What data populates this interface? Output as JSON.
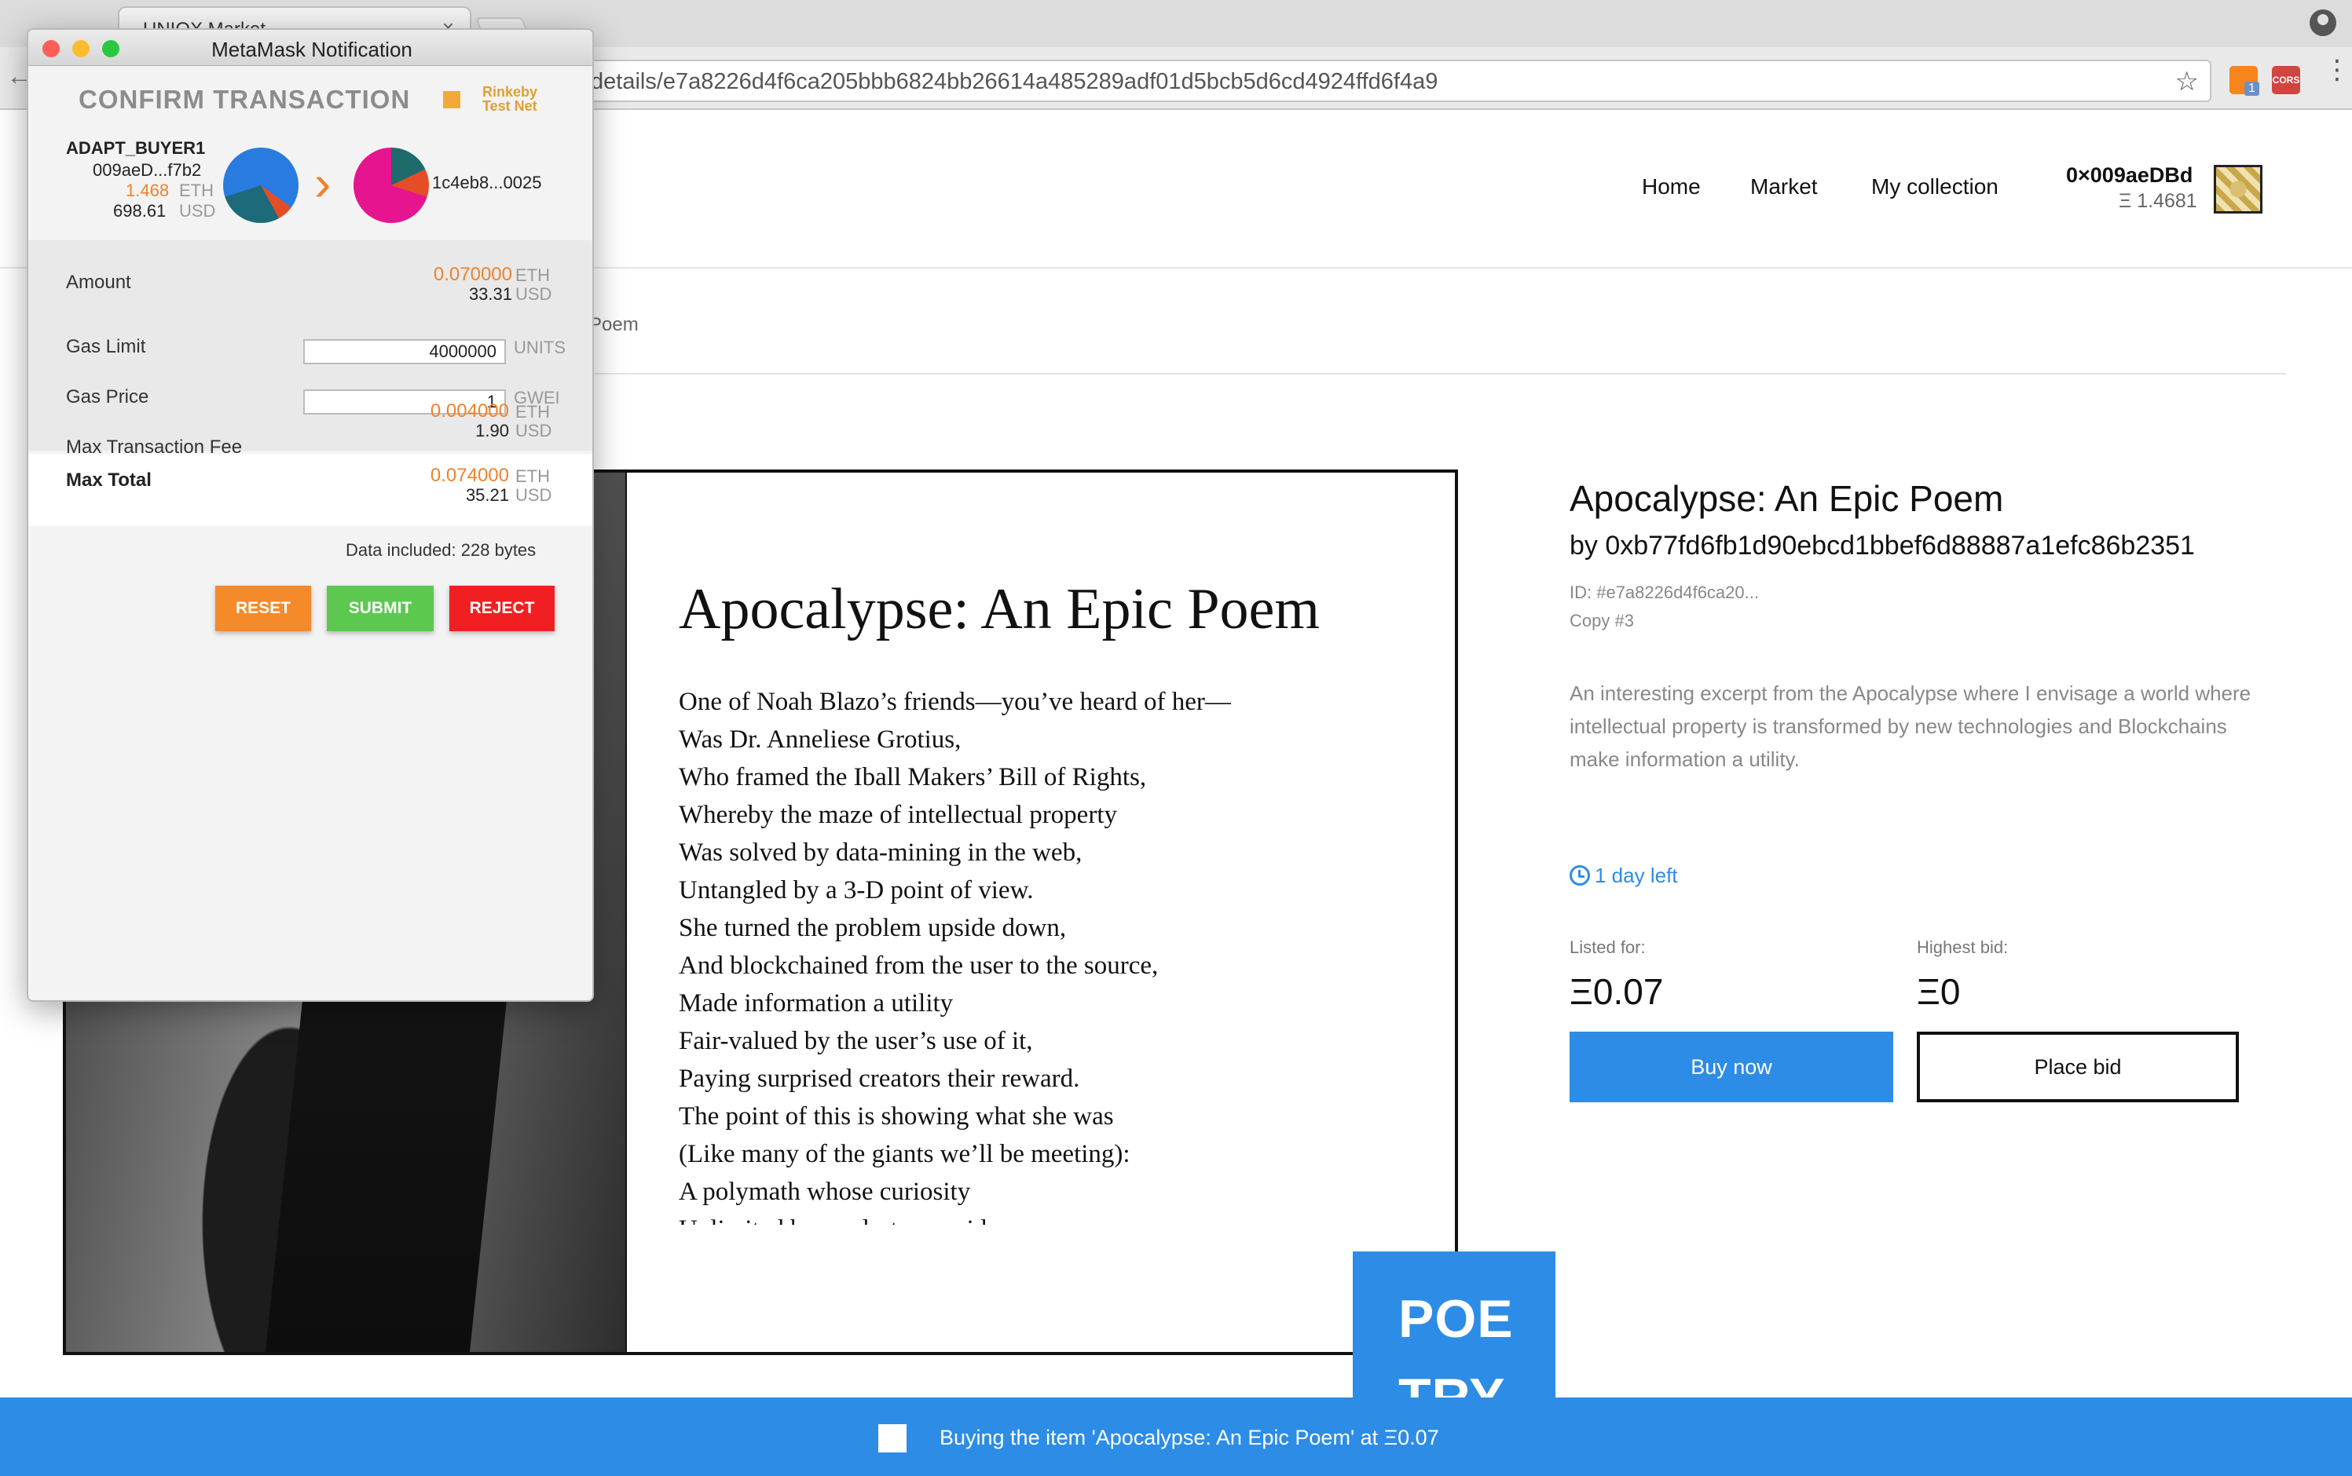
{
  "browser": {
    "tab_title": "UNIQX Market",
    "tab_close": "×",
    "back": "←",
    "url": "details/e7a8226d4f6ca205bbb6824bb26614a485289adf01d5bcb5d6cd4924ffd6f4a9",
    "star": "☆",
    "ext_cors": "CORS",
    "ext_metamask_badge": "1",
    "menu": "⋮"
  },
  "site": {
    "nav": {
      "home": "Home",
      "market": "Market",
      "collection": "My collection"
    },
    "account": {
      "address": "0×009aeDBd",
      "balance": "Ξ 1.4681"
    },
    "breadcrumb_fragment": "Poem"
  },
  "artwork": {
    "title": "Apocalypse: An Epic Poem",
    "lines": [
      "One of Noah Blazo’s friends—you’ve heard of her—",
      "Was Dr. Anneliese Grotius,",
      "Who framed the Iball Makers’ Bill of Rights,",
      "Whereby the maze of intellectual property",
      "Was solved by data-mining in the web,",
      "Untangled by a 3-D point of view.",
      "She turned the problem upside down,",
      "And blockchained from the user to the source,",
      "Made information a utility",
      "Fair-valued by the user’s use of it,",
      "Paying surprised creators their reward.",
      "The point of this is showing what she was",
      "(Like many of the giants we’ll be meeting):",
      "A polymath whose curiosity",
      "Unlimited by modesty or pride"
    ],
    "badge_text": "POE\nTRY"
  },
  "item": {
    "title": "Apocalypse: An Epic Poem",
    "author": "by 0xb77fd6fb1d90ebcd1bbef6d88887a1efc86b2351",
    "id": "ID: #e7a8226d4f6ca20...",
    "copy": "Copy #3",
    "description": "An interesting excerpt from the Apocalypse where I envisage a world where intellectual property is transformed by new technologies and Blockchains make information a utility.",
    "time_left": "1 day left",
    "listed_label": "Listed for:",
    "listed_value": "Ξ0.07",
    "highest_bid_label": "Highest bid:",
    "highest_bid_value": "Ξ0",
    "buy_label": "Buy now",
    "bid_label": "Place bid"
  },
  "status_bar": {
    "text": "Buying the item 'Apocalypse: An Epic Poem' at Ξ0.07"
  },
  "metamask": {
    "window_title": "MetaMask Notification",
    "heading": "CONFIRM TRANSACTION",
    "network": "Rinkeby Test Net",
    "from": {
      "name": "ADAPT_BUYER1",
      "address": "009aeD...f7b2",
      "eth": "1.468",
      "eth_unit": "ETH",
      "usd": "698.61",
      "usd_unit": "USD"
    },
    "to": {
      "address": "1c4eb8...0025"
    },
    "rows": {
      "amount": {
        "label": "Amount",
        "eth": "0.070000",
        "usd": "33.31"
      },
      "gas_limit": {
        "label": "Gas Limit",
        "value": "4000000",
        "unit": "UNITS"
      },
      "gas_price": {
        "label": "Gas Price",
        "value": "1",
        "unit": "GWEI"
      },
      "max_fee": {
        "label": "Max Transaction Fee",
        "eth": "0.004000",
        "usd": "1.90"
      },
      "max_total": {
        "label": "Max Total",
        "eth": "0.074000",
        "usd": "35.21"
      }
    },
    "units": {
      "eth": "ETH",
      "usd": "USD"
    },
    "data_included": "Data included: 228 bytes",
    "buttons": {
      "reset": "RESET",
      "submit": "SUBMIT",
      "reject": "REJECT"
    }
  }
}
